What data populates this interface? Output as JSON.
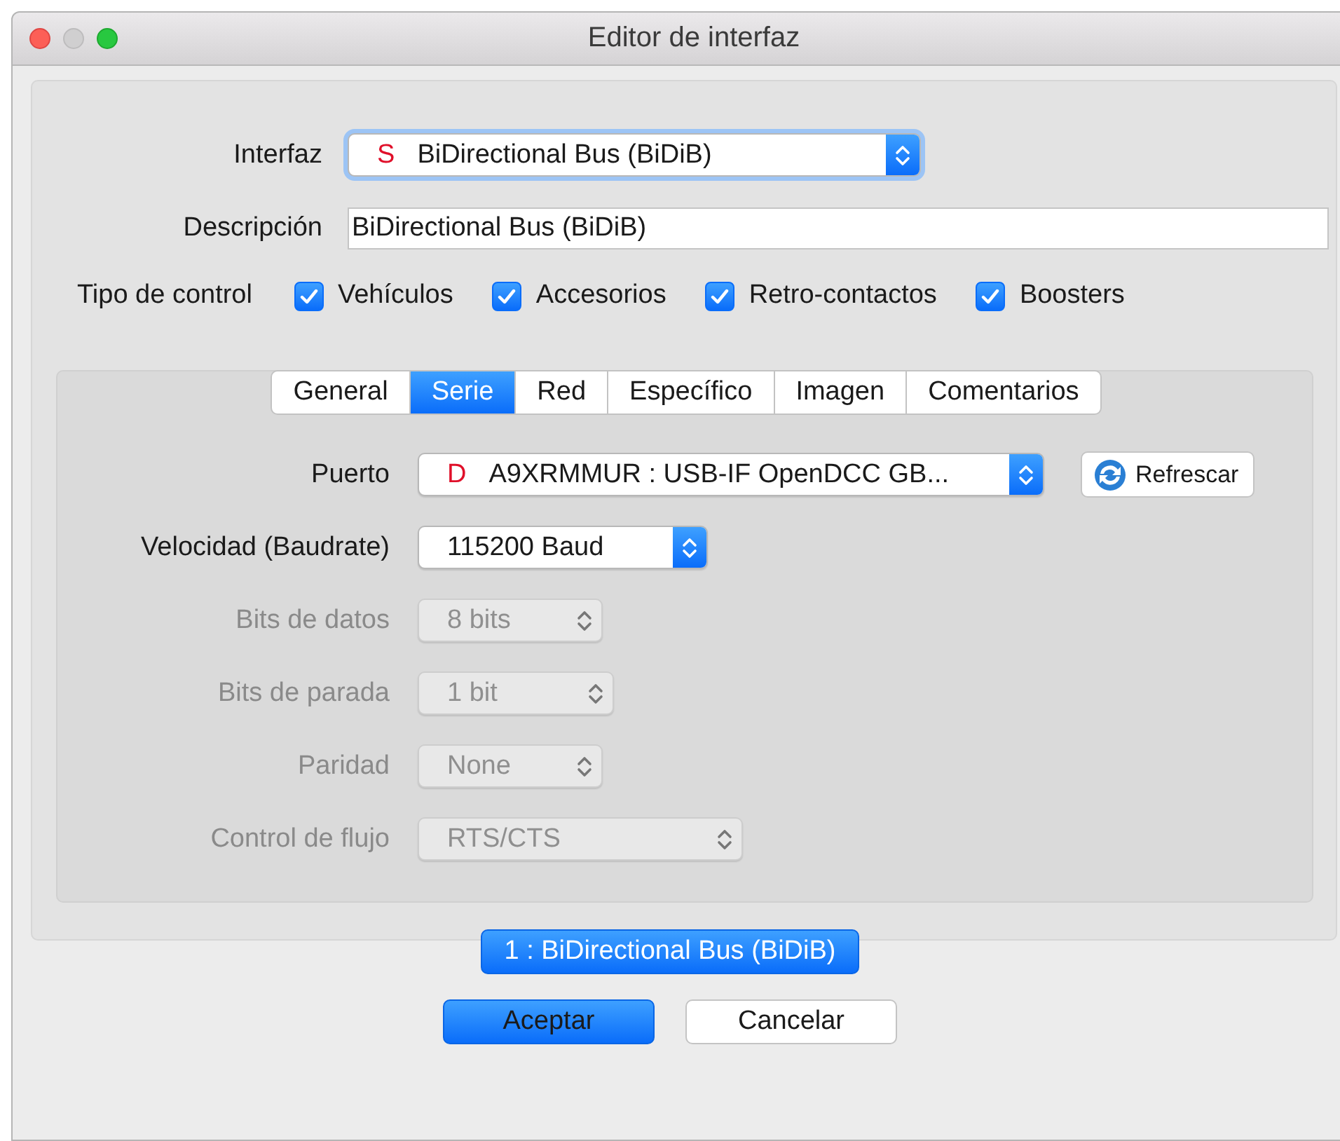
{
  "window": {
    "title": "Editor de interfaz",
    "controls": [
      {
        "kind": "close"
      },
      {
        "kind": "minimize",
        "disabled": true
      },
      {
        "kind": "zoom"
      }
    ]
  },
  "interface": {
    "label": "Interfaz",
    "flag": "S",
    "value": "BiDirectional Bus (BiDiB)"
  },
  "description": {
    "label": "Descripción",
    "value": "BiDirectional Bus (BiDiB)"
  },
  "control_type": {
    "label": "Tipo de control",
    "options": [
      {
        "label": "Vehículos",
        "checked": true
      },
      {
        "label": "Accesorios",
        "checked": true
      },
      {
        "label": "Retro-contactos",
        "checked": true
      },
      {
        "label": "Boosters",
        "checked": true
      }
    ]
  },
  "tabs": [
    {
      "label": "General",
      "selected": false
    },
    {
      "label": "Serie",
      "selected": true
    },
    {
      "label": "Red",
      "selected": false
    },
    {
      "label": "Específico",
      "selected": false
    },
    {
      "label": "Imagen",
      "selected": false
    },
    {
      "label": "Comentarios",
      "selected": false
    }
  ],
  "serial": {
    "fields": [
      {
        "label": "Puerto",
        "flag": "D",
        "value": "A9XRMMUR : USB-IF OpenDCC GB...",
        "disabled": false,
        "button": "Refrescar"
      },
      {
        "label": "Velocidad (Baudrate)",
        "value": "115200 Baud",
        "disabled": false
      },
      {
        "label": "Bits de datos",
        "value": "8 bits",
        "disabled": true
      },
      {
        "label": "Bits de parada",
        "value": "1 bit",
        "disabled": true
      },
      {
        "label": "Paridad",
        "value": "None",
        "disabled": true
      },
      {
        "label": "Control de flujo",
        "value": "RTS/CTS",
        "disabled": true
      }
    ]
  },
  "selected_interface": "1 : BiDirectional Bus (BiDiB)",
  "buttons": [
    {
      "label": "Aceptar",
      "default": true
    },
    {
      "label": "Cancelar",
      "default": false
    }
  ]
}
